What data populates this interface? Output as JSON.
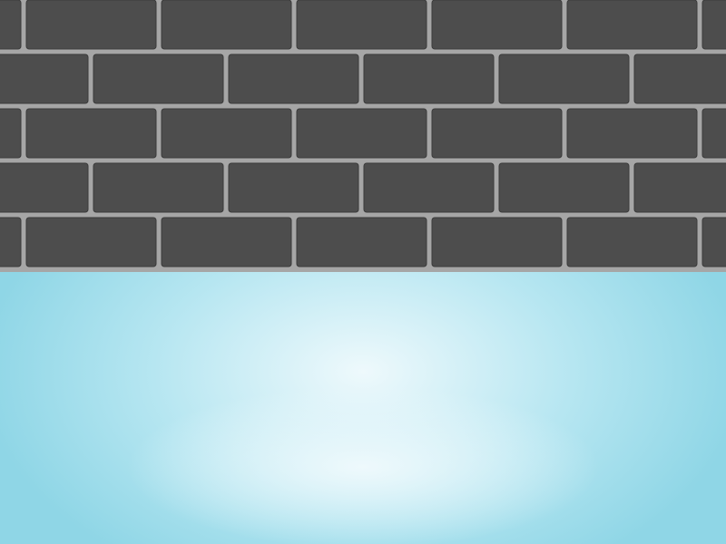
{
  "scene": {
    "wall": {
      "brick_color": "#4d4d4d",
      "brick_border_color": "#3a3a3a",
      "mortar_color": "#a6a6a6",
      "row_count": 5
    },
    "floor": {
      "edge_color": "#8fd6e6",
      "mid_color": "#b6e6f1",
      "highlight_color": "#eef9fc"
    }
  }
}
